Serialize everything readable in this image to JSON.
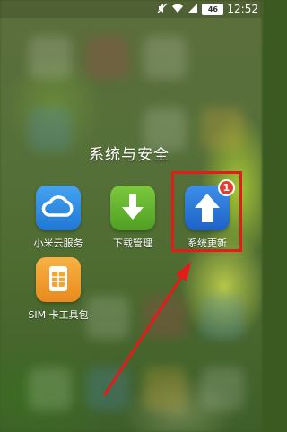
{
  "status_bar": {
    "battery": "46",
    "time": "12:52",
    "icons": [
      "mute-icon",
      "wifi-icon",
      "signal-icon",
      "battery-icon"
    ]
  },
  "folder": {
    "title": "系统与安全",
    "apps": [
      {
        "label": "小米云服务",
        "icon": "cloud-icon",
        "color": "#2d8ae0"
      },
      {
        "label": "下载管理",
        "icon": "download-icon",
        "color": "#63b230"
      },
      {
        "label": "系统更新",
        "icon": "up-arrow-icon",
        "color": "#2672d6",
        "badge": "1"
      },
      {
        "label": "SIM 卡工具包",
        "icon": "sim-card-icon",
        "color": "#f29d2c"
      }
    ]
  },
  "annotation": {
    "box_color": "#e21b1b",
    "arrow_color": "#e21b1b"
  }
}
